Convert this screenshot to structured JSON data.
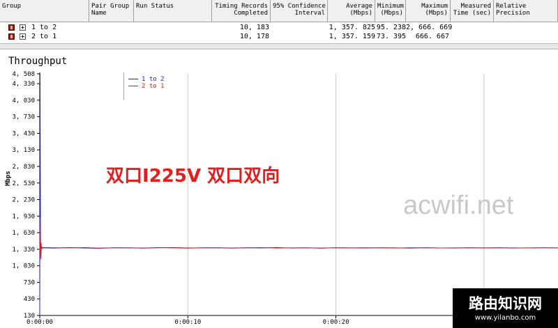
{
  "table": {
    "headers": [
      {
        "name": "hdr-group",
        "lines": [
          "Group"
        ]
      },
      {
        "name": "hdr-pair-group-name",
        "lines": [
          "Pair Group",
          "Name"
        ]
      },
      {
        "name": "hdr-run-status",
        "lines": [
          "Run Status"
        ]
      },
      {
        "name": "hdr-timing-records",
        "lines": [
          "Timing Records",
          "Completed"
        ]
      },
      {
        "name": "hdr-confidence",
        "lines": [
          "95% Confidence",
          "Interval"
        ]
      },
      {
        "name": "hdr-average",
        "lines": [
          "Average",
          "(Mbps)"
        ]
      },
      {
        "name": "hdr-minimum",
        "lines": [
          "Minimum",
          "(Mbps)"
        ]
      },
      {
        "name": "hdr-maximum",
        "lines": [
          "Maximum",
          "(Mbps)"
        ]
      },
      {
        "name": "hdr-measured-time",
        "lines": [
          "Measured",
          "Time (sec)"
        ]
      },
      {
        "name": "hdr-relative-precision",
        "lines": [
          "Relative",
          "Precision"
        ]
      }
    ],
    "rows": [
      {
        "group": "1 to 2",
        "records": "10, 183",
        "average": "1, 357. 825",
        "minimum": "95. 238",
        "maximum": "2, 666. 669"
      },
      {
        "group": "2 to 1",
        "records": "10, 178",
        "average": "1, 357. 159",
        "minimum": "73. 395",
        "maximum": "666. 667"
      }
    ]
  },
  "chart": {
    "title": "Throughput",
    "ylabel": "Mbps",
    "legend": [
      {
        "label": "1 to 2",
        "color": "#1a1adc"
      },
      {
        "label": "2 to 1",
        "color": "#e01818"
      }
    ],
    "yticks": [
      "4, 508",
      "4, 330",
      "4, 030",
      "3, 730",
      "3, 430",
      "3, 130",
      "2, 830",
      "2, 530",
      "2, 230",
      "1, 930",
      "1, 630",
      "1, 330",
      "1, 030",
      "730",
      "430",
      "130"
    ],
    "xticks": [
      "0:00:00",
      "0:00:10",
      "0:00:20"
    ]
  },
  "overlay": {
    "red_caption": "双口I225V 双口双向",
    "watermark": "acwifi.net",
    "corner_title": "路由知识网",
    "corner_url": "www.yilanbo.com"
  },
  "chart_data": {
    "type": "line",
    "title": "Throughput",
    "ylabel": "Mbps",
    "xlabel": "",
    "ylim": [
      130,
      4508
    ],
    "xlim_seconds": [
      0,
      35
    ],
    "grid": true,
    "legend_position": "top-left",
    "series": [
      {
        "name": "1 to 2",
        "color": "#1a1adc",
        "x": [
          0,
          0.02,
          0.05,
          0.08,
          0.1,
          0.3,
          1,
          2,
          3,
          4,
          5,
          6,
          7,
          8,
          9,
          10,
          11,
          12,
          13,
          14,
          15,
          16,
          17,
          18,
          19,
          20,
          21,
          22,
          23,
          24,
          25,
          26,
          27,
          28,
          29,
          30,
          31,
          32,
          33,
          34,
          35
        ],
        "y": [
          130,
          4508,
          1480,
          1200,
          1370,
          1355,
          1350,
          1360,
          1352,
          1348,
          1358,
          1355,
          1350,
          1357,
          1360,
          1352,
          1355,
          1358,
          1350,
          1356,
          1354,
          1360,
          1352,
          1355,
          1350,
          1358,
          1355,
          1352,
          1357,
          1355,
          1350,
          1356,
          1354,
          1352,
          1358,
          1355,
          1357,
          1352,
          1355,
          1356,
          1354
        ]
      },
      {
        "name": "2 to 1",
        "color": "#e01818",
        "x": [
          0,
          0.03,
          0.06,
          0.09,
          0.12,
          0.3,
          1,
          2,
          3,
          4,
          5,
          6,
          7,
          8,
          9,
          10,
          11,
          12,
          13,
          14,
          15,
          16,
          17,
          18,
          19,
          20,
          21,
          22,
          23,
          24,
          25,
          26,
          27,
          28,
          29,
          30,
          31,
          32,
          33,
          34,
          35
        ],
        "y": [
          1300,
          1900,
          1150,
          1450,
          1340,
          1362,
          1358,
          1355,
          1360,
          1350,
          1356,
          1358,
          1352,
          1360,
          1355,
          1350,
          1358,
          1356,
          1354,
          1357,
          1360,
          1352,
          1355,
          1358,
          1350,
          1356,
          1354,
          1357,
          1355,
          1352,
          1358,
          1356,
          1354,
          1355,
          1357,
          1352,
          1358,
          1355,
          1354,
          1356,
          1355
        ]
      }
    ]
  }
}
